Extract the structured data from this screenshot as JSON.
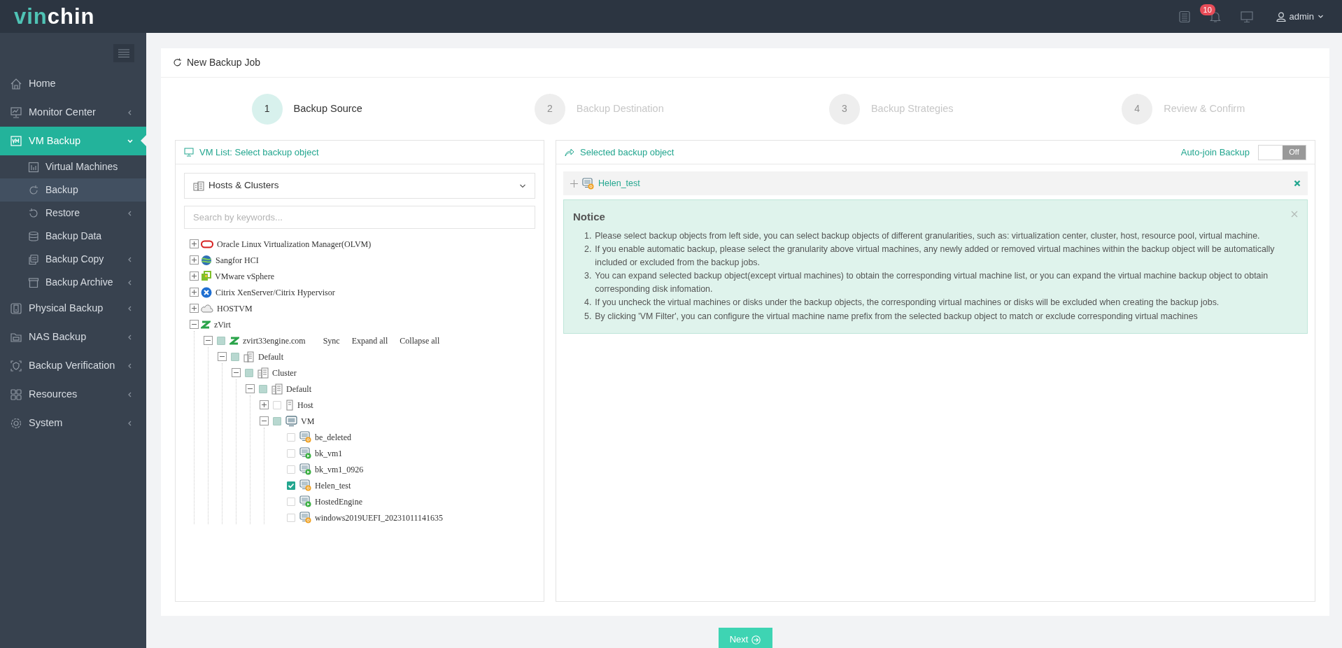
{
  "topbar": {
    "logo": [
      "vin",
      "chin"
    ],
    "notifications": "10",
    "user": "admin"
  },
  "sidebar": {
    "items": [
      {
        "label": "Home",
        "selected": false
      },
      {
        "label": "Monitor Center",
        "selected": false,
        "expanded": false
      },
      {
        "label": "VM Backup",
        "selected": true,
        "expanded": true,
        "children": [
          {
            "label": "Virtual Machines",
            "selected": false
          },
          {
            "label": "Backup",
            "selected": true
          },
          {
            "label": "Restore",
            "selected": false,
            "expanded": false
          },
          {
            "label": "Backup Data",
            "selected": false
          },
          {
            "label": "Backup Copy",
            "selected": false,
            "expanded": false
          },
          {
            "label": "Backup Archive",
            "selected": false,
            "expanded": false
          }
        ]
      },
      {
        "label": "Physical Backup",
        "selected": false,
        "expanded": false
      },
      {
        "label": "NAS Backup",
        "selected": false,
        "expanded": false
      },
      {
        "label": "Backup Verification",
        "selected": false,
        "expanded": false
      },
      {
        "label": "Resources",
        "selected": false,
        "expanded": false
      },
      {
        "label": "System",
        "selected": false,
        "expanded": false
      }
    ]
  },
  "page": {
    "title": "New Backup Job"
  },
  "steps": [
    {
      "number": "1",
      "label": "Backup Source",
      "selected": true
    },
    {
      "number": "2",
      "label": "Backup Destination",
      "selected": false
    },
    {
      "number": "3",
      "label": "Backup Strategies",
      "selected": false
    },
    {
      "number": "4",
      "label": "Review & Confirm",
      "selected": false
    }
  ],
  "vm_list": {
    "title": "VM List: Select backup object",
    "view": "Hosts & Clusters",
    "search": {
      "placeholder": "Search by keywords..."
    },
    "tree": [
      {
        "label": "Oracle Linux Virtualization Manager(OLVM)",
        "kind": "oracle",
        "expanded": false
      },
      {
        "label": "Sangfor HCI",
        "kind": "sangfor",
        "expanded": false
      },
      {
        "label": "VMware vSphere",
        "kind": "vmware",
        "expanded": false
      },
      {
        "label": "Citrix XenServer/Citrix Hypervisor",
        "kind": "citrix",
        "expanded": false
      },
      {
        "label": "HOSTVM",
        "kind": "hostvm",
        "expanded": false
      },
      {
        "label": "zVirt",
        "kind": "zvirt",
        "expanded": true,
        "children": [
          {
            "label": "zvirt33engine.com",
            "kind": "zvirt",
            "expanded": true,
            "checked": false,
            "partial": true,
            "actions": [
              "Sync",
              "Expand all",
              "Collapse all"
            ],
            "children": [
              {
                "label": "Default",
                "kind": "datacenter",
                "expanded": true,
                "checked": false,
                "partial": true,
                "children": [
                  {
                    "label": "Cluster",
                    "kind": "cluster",
                    "expanded": true,
                    "checked": false,
                    "partial": true,
                    "children": [
                      {
                        "label": "Default",
                        "kind": "cluster",
                        "expanded": true,
                        "checked": false,
                        "partial": true,
                        "children": [
                          {
                            "label": "Host",
                            "kind": "host",
                            "expanded": false,
                            "checked": false,
                            "partial": false
                          },
                          {
                            "label": "VM",
                            "kind": "vmgroup",
                            "expanded": true,
                            "checked": false,
                            "partial": true,
                            "children": [
                              {
                                "label": "be_deleted",
                                "kind": "vm",
                                "running": false,
                                "checked": false
                              },
                              {
                                "label": "bk_vm1",
                                "kind": "vm",
                                "running": true,
                                "checked": false
                              },
                              {
                                "label": "bk_vm1_0926",
                                "kind": "vm",
                                "running": true,
                                "checked": false
                              },
                              {
                                "label": "Helen_test",
                                "kind": "vm",
                                "running": false,
                                "checked": true
                              },
                              {
                                "label": "HostedEngine",
                                "kind": "vm",
                                "running": true,
                                "checked": false
                              },
                              {
                                "label": "windows2019UEFI_20231011141635",
                                "kind": "vm",
                                "running": false,
                                "checked": false
                              }
                            ]
                          }
                        ]
                      }
                    ]
                  }
                ]
              }
            ]
          }
        ]
      }
    ]
  },
  "selected_panel": {
    "title": "Selected backup object",
    "auto_join": {
      "label": "Auto-join Backup",
      "on": false,
      "state_label": "Off"
    },
    "objects": [
      {
        "label": "Helen_test",
        "running": false
      }
    ],
    "notice": {
      "title": "Notice",
      "items": [
        {
          "number": "1.",
          "text": "Please select backup objects from left side, you can select backup objects of different granularities, such as: virtualization center, cluster, host, resource pool, virtual machine."
        },
        {
          "number": "2.",
          "text": "If you enable automatic backup, please select the granularity above virtual machines, any newly added or removed virtual machines within the backup object will be automatically included or excluded from the backup jobs."
        },
        {
          "number": "3.",
          "text": "You can expand selected backup object(except virtual machines) to obtain the corresponding virtual machine list, or you can expand the virtual machine backup object to obtain corresponding disk infomation."
        },
        {
          "number": "4.",
          "text": "If you uncheck the virtual machines or disks under the backup objects, the corresponding virtual machines or disks will be excluded when creating the backup jobs."
        },
        {
          "number": "5.",
          "text": "By clicking 'VM Filter', you can configure the virtual machine name prefix from the selected backup object to match or exclude corresponding virtual machines"
        }
      ]
    }
  },
  "footer": {
    "next": "Next"
  }
}
